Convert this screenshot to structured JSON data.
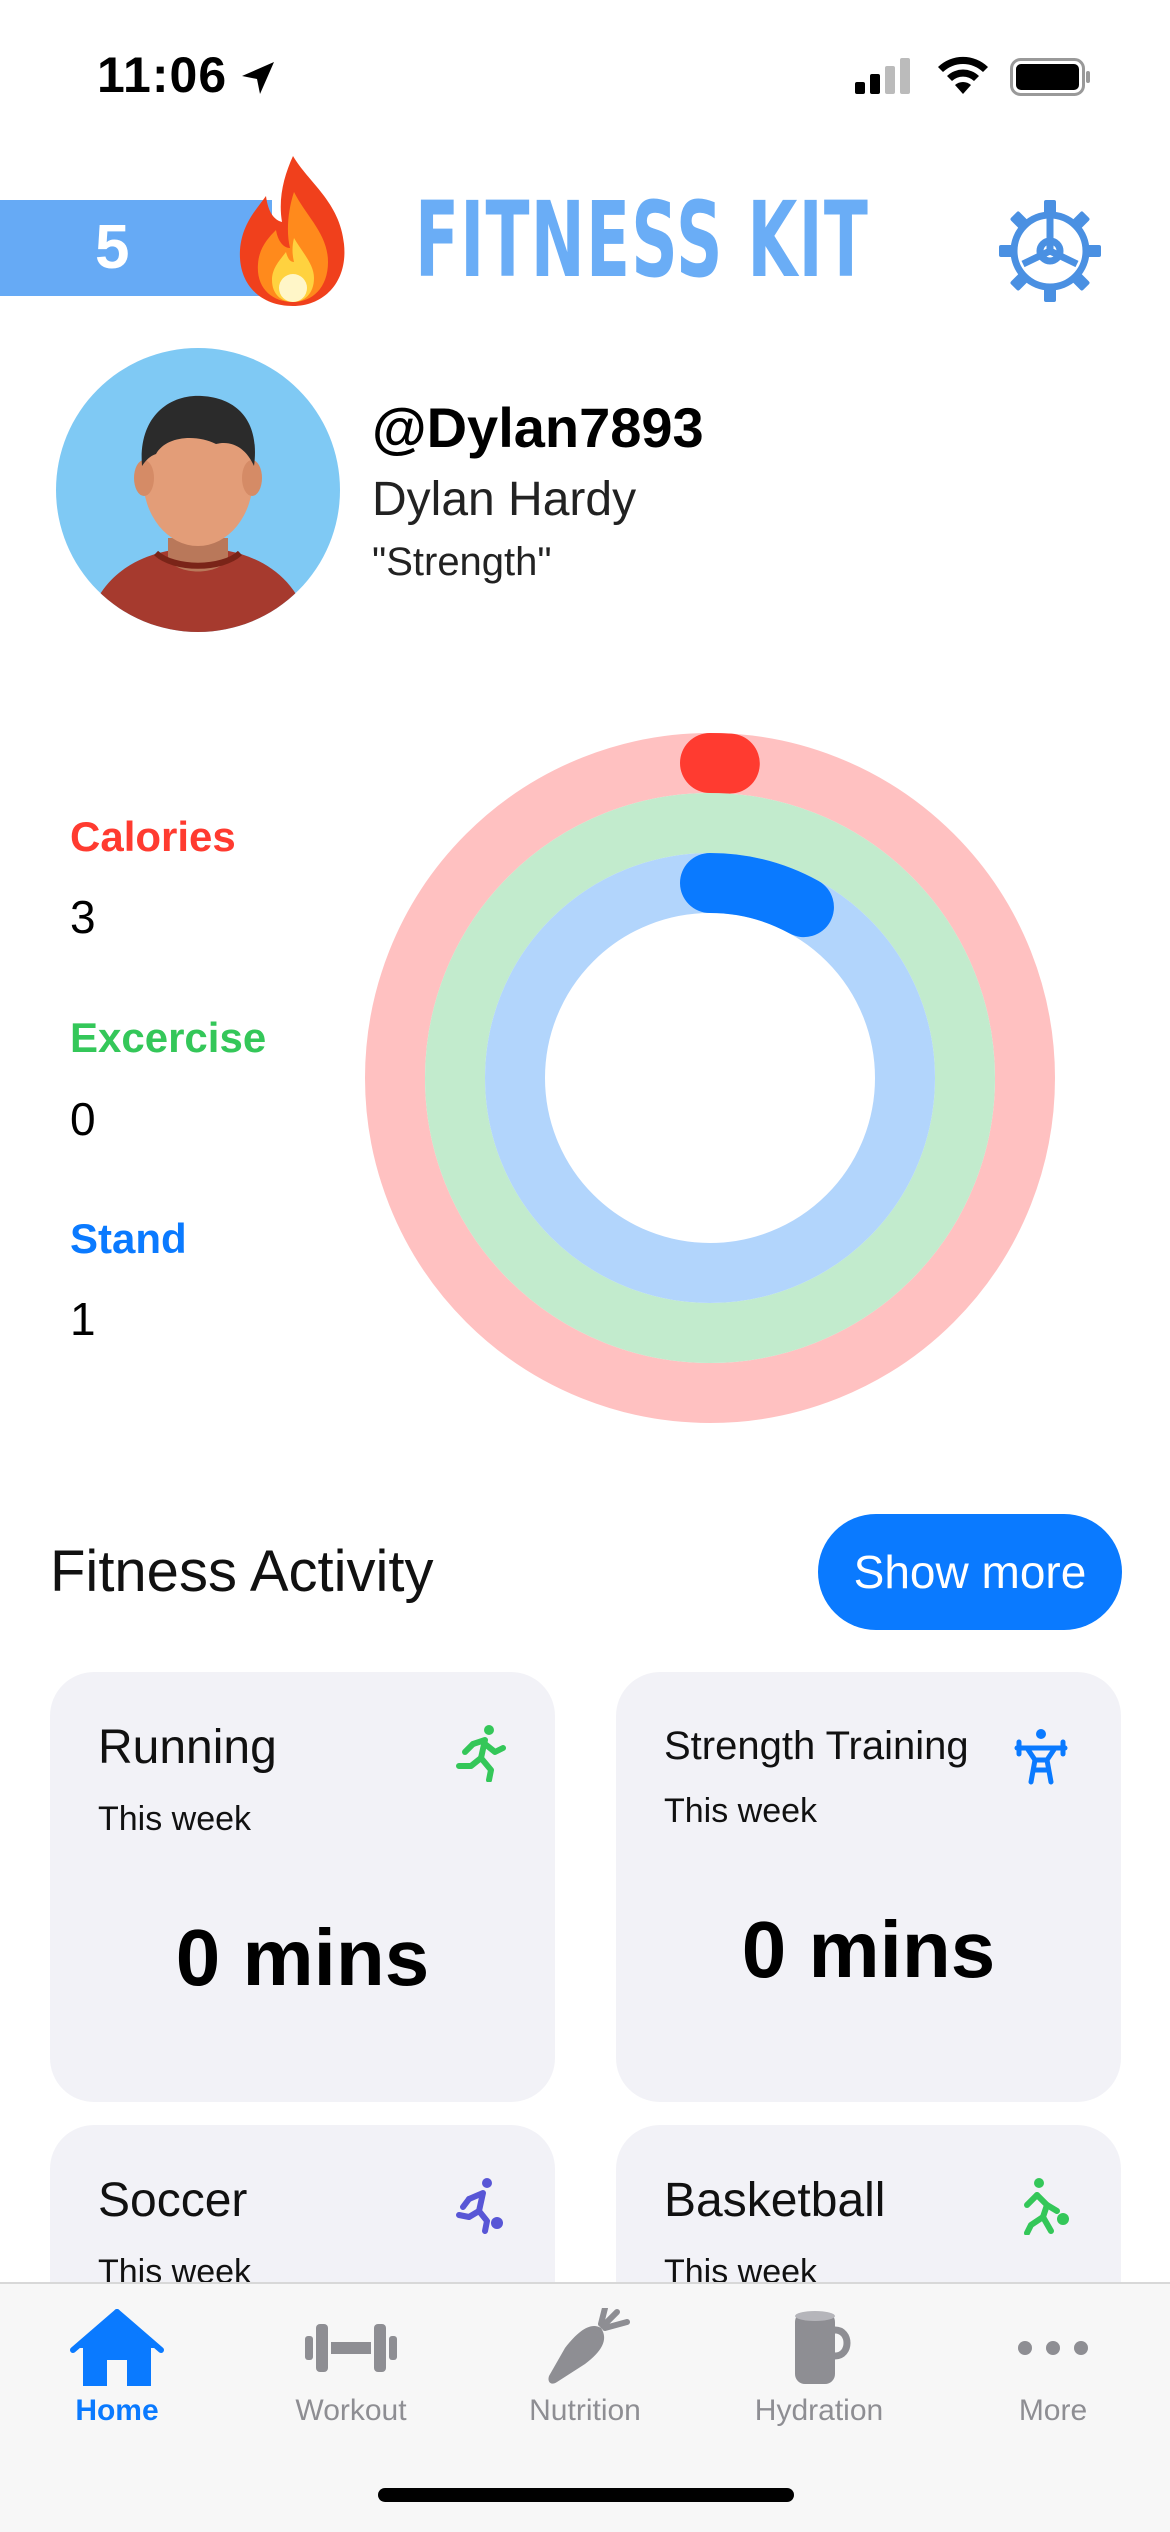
{
  "status_bar": {
    "time": "11:06"
  },
  "header": {
    "streak_count": "5",
    "title": "FITNESS KIT",
    "streak_icon": "fire-icon",
    "settings_icon": "gear-icon",
    "accent_color": "#6aadf6"
  },
  "profile": {
    "username": "@Dylan7893",
    "full_name": "Dylan Hardy",
    "tag": "\"Strength\""
  },
  "rings": {
    "calories": {
      "label": "Calories",
      "value": "3",
      "color": "#ff3b30",
      "progress": 0.01
    },
    "exercise": {
      "label": "Excercise",
      "value": "0",
      "color": "#34c759",
      "progress": 0.0
    },
    "stand": {
      "label": "Stand",
      "value": "1",
      "color": "#0a7aff",
      "progress": 0.08
    }
  },
  "activity": {
    "title": "Fitness Activity",
    "show_more": "Show more",
    "cards": [
      {
        "title": "Running",
        "subtitle": "This week",
        "value": "0 mins",
        "icon": "running-icon"
      },
      {
        "title": "Strength Training",
        "subtitle": "This week",
        "value": "0 mins",
        "icon": "weightlifting-icon"
      },
      {
        "title": "Soccer",
        "subtitle": "This week",
        "value": "",
        "icon": "soccer-icon"
      },
      {
        "title": "Basketball",
        "subtitle": "This week",
        "value": "",
        "icon": "basketball-icon"
      }
    ]
  },
  "tab_bar": {
    "items": [
      {
        "label": "Home",
        "icon": "house-icon",
        "active": true
      },
      {
        "label": "Workout",
        "icon": "dumbbell-icon",
        "active": false
      },
      {
        "label": "Nutrition",
        "icon": "carrot-icon",
        "active": false
      },
      {
        "label": "Hydration",
        "icon": "mug-icon",
        "active": false
      },
      {
        "label": "More",
        "icon": "more-icon",
        "active": false
      }
    ]
  }
}
